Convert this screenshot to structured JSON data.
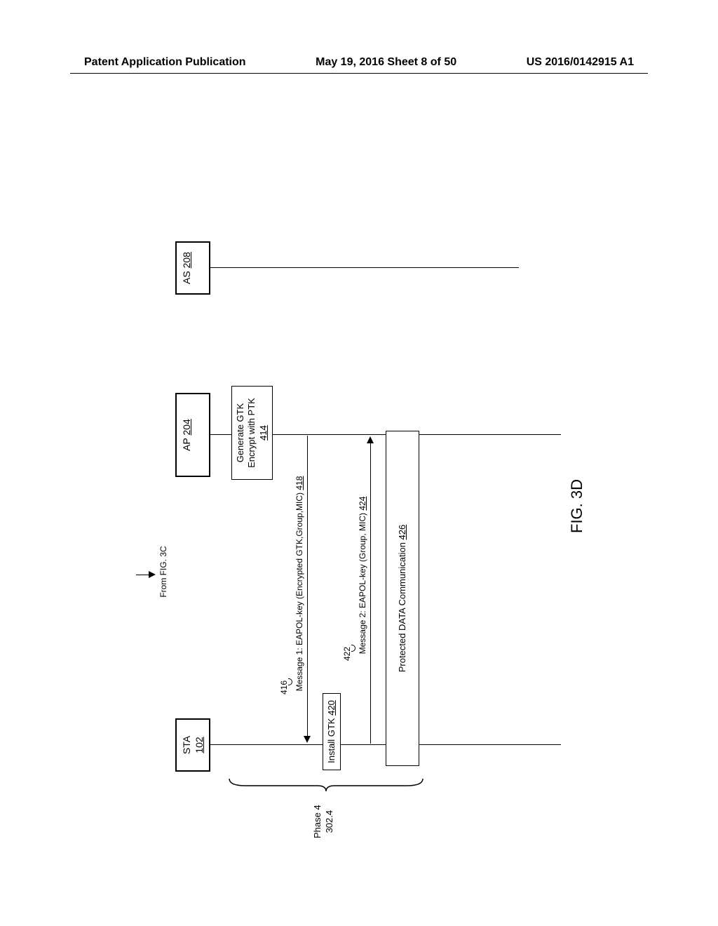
{
  "header": {
    "left": "Patent Application Publication",
    "center": "May 19, 2016  Sheet 8 of 50",
    "right": "US 2016/0142915 A1"
  },
  "entities": {
    "sta": {
      "label": "STA",
      "ref": "102"
    },
    "ap": {
      "label": "AP",
      "ref": "204"
    },
    "as": {
      "label": "AS",
      "ref": "208"
    }
  },
  "continuation": "From FIG. 3C",
  "boxes": {
    "generate": {
      "line1": "Generate GTK",
      "line2": "Encrypt with PTK",
      "ref": "414"
    },
    "install": {
      "label": "Install GTK",
      "ref": "420"
    },
    "protected": {
      "label": "Protected DATA Communication",
      "ref": "426"
    }
  },
  "messages": {
    "msg1": {
      "pre": "416",
      "text": "Message 1: EAPOL-key (Encrypted GTK,Group,MIC)",
      "ref": "418"
    },
    "msg2": {
      "pre": "422",
      "text": "Message 2: EAPOL-key (Group, MIC)",
      "ref": "424"
    }
  },
  "phase": {
    "label": "Phase 4",
    "ref": "302.4"
  },
  "figure": "FIG. 3D"
}
